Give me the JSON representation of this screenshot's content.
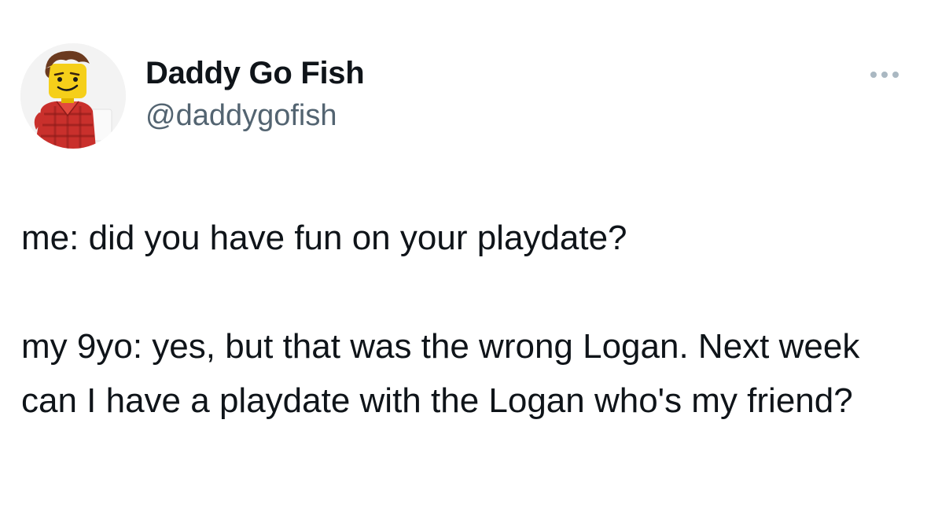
{
  "author": {
    "display_name": "Daddy Go Fish",
    "handle": "@daddygofish",
    "avatar_icon": "lego-minifigure-avatar"
  },
  "menu": {
    "icon": "more-options-icon"
  },
  "tweet": {
    "line1": "me: did you have fun on your playdate?",
    "line2": "my 9yo: yes, but that was the wrong Logan. Next week can I have a playdate with the Logan who's my friend?"
  },
  "colors": {
    "text_primary": "#0f1419",
    "text_secondary": "#536471",
    "background": "#ffffff"
  }
}
